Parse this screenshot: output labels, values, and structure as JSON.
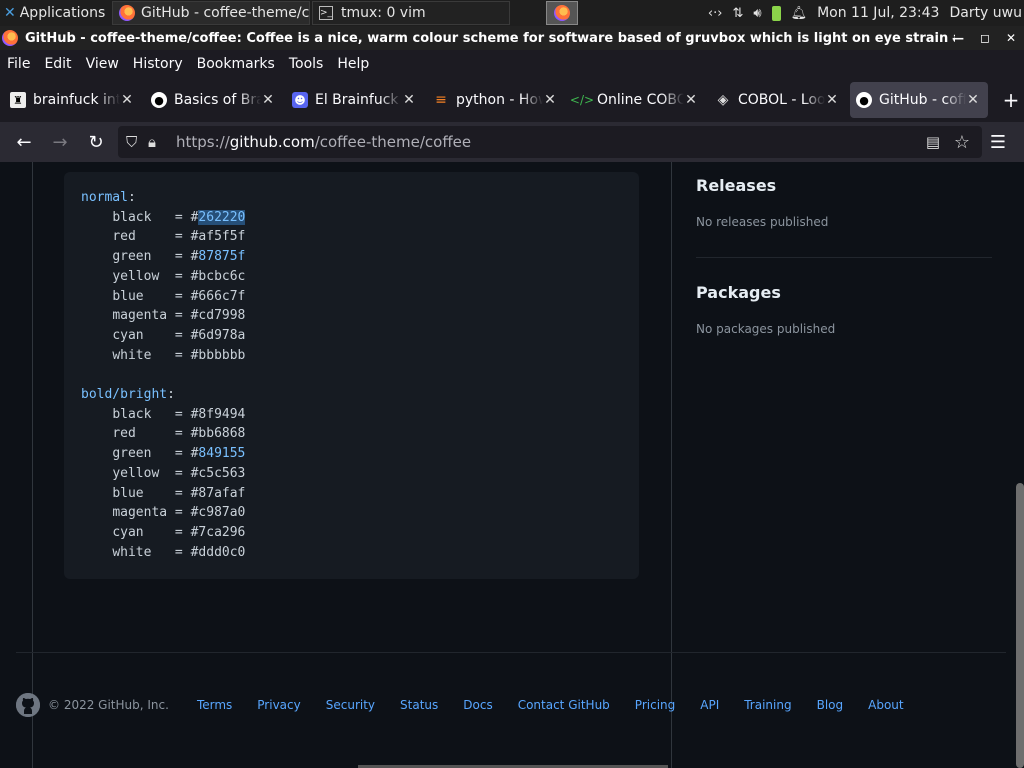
{
  "taskbar": {
    "apps_label": "Applications",
    "apps_suffix": "⋮",
    "task1": "GitHub - coffee-theme/c...",
    "task2": "tmux: 0 vim",
    "clock": "Mon 11 Jul, 23:43",
    "user": "Darty uwu"
  },
  "window": {
    "title": "GitHub - coffee-theme/coffee: Coffee is a nice, warm colour scheme for software based of gruvbox which is light on eye strain and fee"
  },
  "menu": [
    "File",
    "Edit",
    "View",
    "History",
    "Bookmarks",
    "Tools",
    "Help"
  ],
  "tabs": [
    {
      "label": "brainfuck interpreter",
      "icon": "brainfuck-favicon"
    },
    {
      "label": "Basics of Brainfuck",
      "icon": "github-favicon"
    },
    {
      "label": "El Brainfuck",
      "icon": "discord-favicon"
    },
    {
      "label": "python - How to",
      "icon": "stackoverflow-favicon"
    },
    {
      "label": "Online COBOL",
      "icon": "code-favicon"
    },
    {
      "label": "COBOL - Look",
      "icon": "cobol-favicon"
    },
    {
      "label": "GitHub - coffee",
      "icon": "github-favicon",
      "active": true
    }
  ],
  "nav": {
    "url_prefix": "https://",
    "url_host": "github.com",
    "url_path": "/coffee-theme/coffee"
  },
  "code": {
    "normal_label": "normal",
    "bold_label": "bold/bright",
    "normal": [
      {
        "name": "black",
        "value": "262220"
      },
      {
        "name": "red",
        "value": "af5f5f"
      },
      {
        "name": "green",
        "value": "87875f"
      },
      {
        "name": "yellow",
        "value": "bcbc6c"
      },
      {
        "name": "blue",
        "value": "666c7f"
      },
      {
        "name": "magenta",
        "value": "cd7998"
      },
      {
        "name": "cyan",
        "value": "6d978a"
      },
      {
        "name": "white",
        "value": "bbbbbb"
      }
    ],
    "bold": [
      {
        "name": "black",
        "value": "8f9494"
      },
      {
        "name": "red",
        "value": "bb6868"
      },
      {
        "name": "green",
        "value": "849155"
      },
      {
        "name": "yellow",
        "value": "c5c563"
      },
      {
        "name": "blue",
        "value": "87afaf"
      },
      {
        "name": "magenta",
        "value": "c987a0"
      },
      {
        "name": "cyan",
        "value": "7ca296"
      },
      {
        "name": "white",
        "value": "ddd0c0"
      }
    ]
  },
  "sidebar": {
    "releases_title": "Releases",
    "releases_text": "No releases published",
    "packages_title": "Packages",
    "packages_text": "No packages published"
  },
  "footer": {
    "copyright": "© 2022 GitHub, Inc.",
    "links": [
      "Terms",
      "Privacy",
      "Security",
      "Status",
      "Docs",
      "Contact GitHub",
      "Pricing",
      "API",
      "Training",
      "Blog",
      "About"
    ]
  }
}
